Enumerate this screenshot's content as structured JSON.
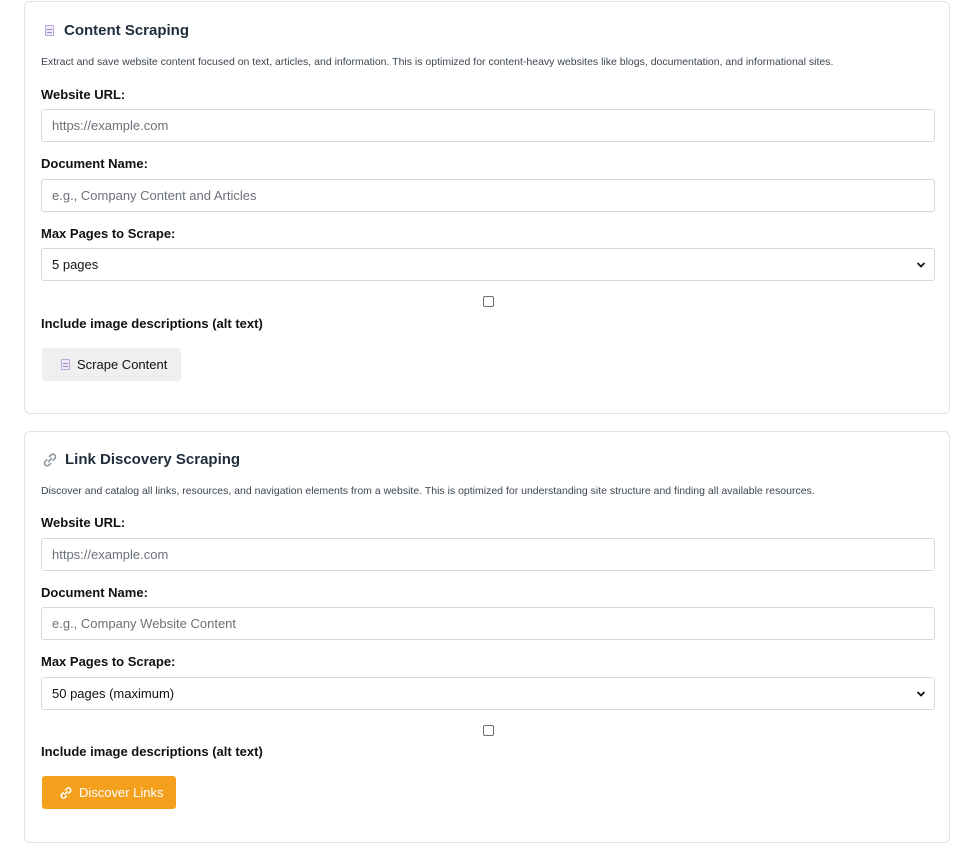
{
  "content_scraping": {
    "title": "Content Scraping",
    "icon": "document-icon",
    "description": "Extract and save website content focused on text, articles, and information. This is optimized for content-heavy websites like blogs, documentation, and informational sites.",
    "url_label": "Website URL:",
    "url_placeholder": "https://example.com",
    "doc_label": "Document Name:",
    "doc_placeholder": "e.g., Company Content and Articles",
    "pages_label": "Max Pages to Scrape:",
    "pages_value": "5 pages",
    "alt_text_label": "Include image descriptions (alt text)",
    "alt_text_checked": false,
    "button_label": "Scrape Content",
    "button_color": "#efefef"
  },
  "link_discovery": {
    "title": "Link Discovery Scraping",
    "icon": "link-icon",
    "description": "Discover and catalog all links, resources, and navigation elements from a website. This is optimized for understanding site structure and finding all available resources.",
    "url_label": "Website URL:",
    "url_placeholder": "https://example.com",
    "doc_label": "Document Name:",
    "doc_placeholder": "e.g., Company Website Content",
    "pages_label": "Max Pages to Scrape:",
    "pages_value": "50 pages (maximum)",
    "alt_text_label": "Include image descriptions (alt text)",
    "alt_text_checked": false,
    "button_label": "Discover Links",
    "button_color": "#f5a01d"
  }
}
